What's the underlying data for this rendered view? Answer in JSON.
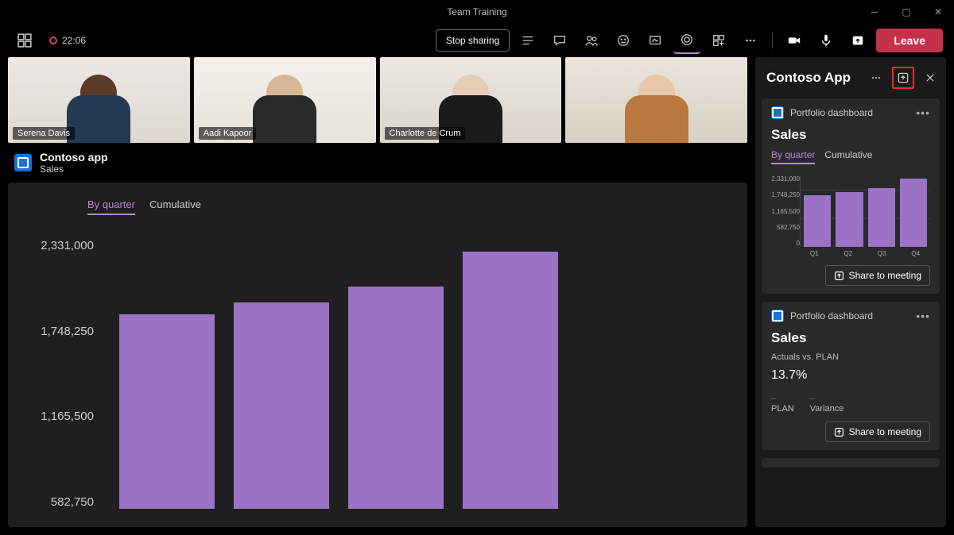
{
  "window": {
    "title": "Team Training"
  },
  "recording_time": "22:06",
  "stop_sharing_label": "Stop sharing",
  "leave_label": "Leave",
  "participants": [
    {
      "name": "Serena Davis"
    },
    {
      "name": "Aadi Kapoor"
    },
    {
      "name": "Charlotte de Crum"
    },
    {
      "name": ""
    }
  ],
  "shared_app": {
    "name": "Contoso app",
    "page": "Sales"
  },
  "tabs": {
    "active": "By quarter",
    "other": "Cumulative"
  },
  "yaxis": [
    "2,331,000",
    "1,748,250",
    "1,165,500",
    "582,750"
  ],
  "side_panel": {
    "title": "Contoso App",
    "card1": {
      "source": "Portfolio dashboard",
      "title": "Sales",
      "tabs": {
        "active": "By quarter",
        "other": "Cumulative"
      },
      "yticks": [
        "2,331,000",
        "1,748,250",
        "1,165,500",
        "582,750",
        "0"
      ],
      "xticks": [
        "Q1",
        "Q2",
        "Q3",
        "Q4"
      ],
      "share_label": "Share to meeting"
    },
    "card2": {
      "source": "Portfolio dashboard",
      "title": "Sales",
      "subtitle": "Actuals vs. PLAN",
      "metric": "13.7%",
      "col1": "PLAN",
      "col2": "Variance",
      "share_label": "Share to meeting"
    }
  },
  "chart_data": {
    "type": "bar",
    "title": "Sales",
    "categories": [
      "Q1",
      "Q2",
      "Q3",
      "Q4"
    ],
    "values": [
      1680000,
      1780000,
      1920000,
      2220000
    ],
    "ylabel": "",
    "xlabel": "",
    "ylim": [
      0,
      2331000
    ],
    "yticks": [
      582750,
      1165500,
      1748250,
      2331000
    ]
  }
}
